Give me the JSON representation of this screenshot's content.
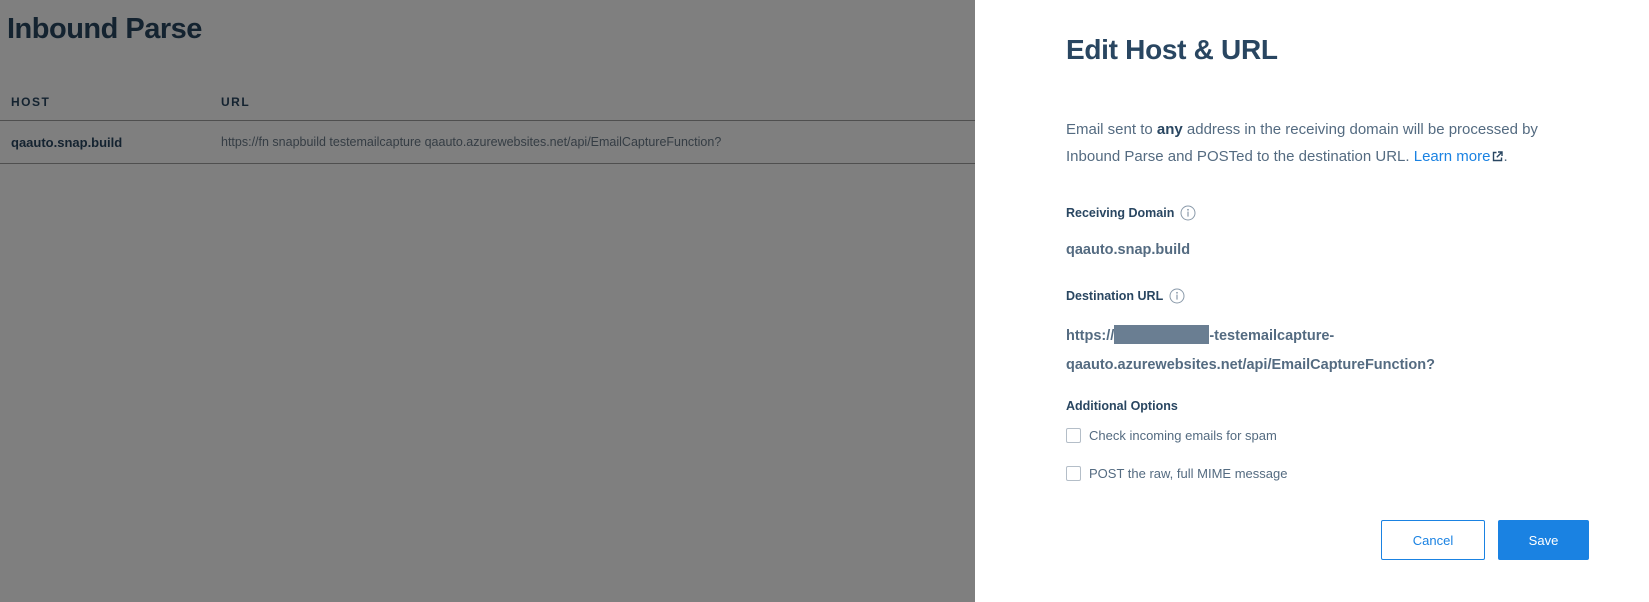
{
  "background": {
    "title": "Inbound Parse",
    "table": {
      "headers": [
        "HOST",
        "URL"
      ],
      "rows": [
        {
          "host": "qaauto.snap.build",
          "url": "https://fn snapbuild testemailcapture qaauto.azurewebsites.net/api/EmailCaptureFunction?"
        }
      ]
    }
  },
  "panel": {
    "title": "Edit Host & URL",
    "description": {
      "prefix": "Email sent to ",
      "emphasis": "any",
      "suffix": " address in the receiving domain will be processed by Inbound Parse and POSTed to the destination URL. ",
      "link_text": "Learn more",
      "end": "."
    },
    "receiving_domain": {
      "label": "Receiving Domain",
      "value": "qaauto.snap.build"
    },
    "destination_url": {
      "label": "Destination URL",
      "line1_prefix": "https://",
      "line1_suffix": "-testemailcapture-",
      "line2": "qaauto.azurewebsites.net/api/EmailCaptureFunction?"
    },
    "additional_options": {
      "label": "Additional Options",
      "options": [
        {
          "label": "Check incoming emails for spam",
          "checked": false
        },
        {
          "label": "POST the raw, full MIME message",
          "checked": false
        }
      ]
    },
    "buttons": {
      "cancel": "Cancel",
      "save": "Save"
    }
  },
  "colors": {
    "heading": "#294661",
    "body_text": "#546b81",
    "accent": "#1a82e2",
    "overlay": "rgba(0,0,0,0.5)"
  }
}
